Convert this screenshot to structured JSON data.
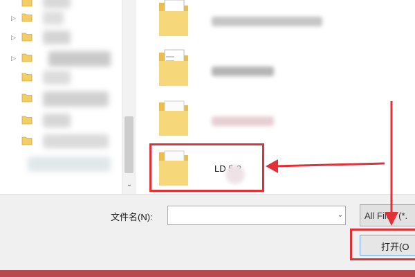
{
  "colors": {
    "annotation_red": "#e13036",
    "folder_yellow": "#f2cf66",
    "bottom_strip": "#b84a4e"
  },
  "nav_tree": {
    "expanders": [
      "▷",
      "▷",
      "▷"
    ],
    "item_count": 7
  },
  "file_list": {
    "items": [
      {
        "name": "",
        "icon": "folder-documents-icon"
      },
      {
        "name": "",
        "icon": "folder-documents-icon"
      },
      {
        "name": "",
        "icon": "folder-icon"
      },
      {
        "name": "LD 5-2",
        "icon": "folder-icon",
        "highlighted": true
      }
    ]
  },
  "scrollbar": {
    "down_arrow": "⌄"
  },
  "bottom_bar": {
    "filename_label": "文件名(N):",
    "filename_value": "",
    "dropdown_icon": "⌄",
    "filetype_value": "All Files (*.",
    "open_label": "打开(O"
  }
}
